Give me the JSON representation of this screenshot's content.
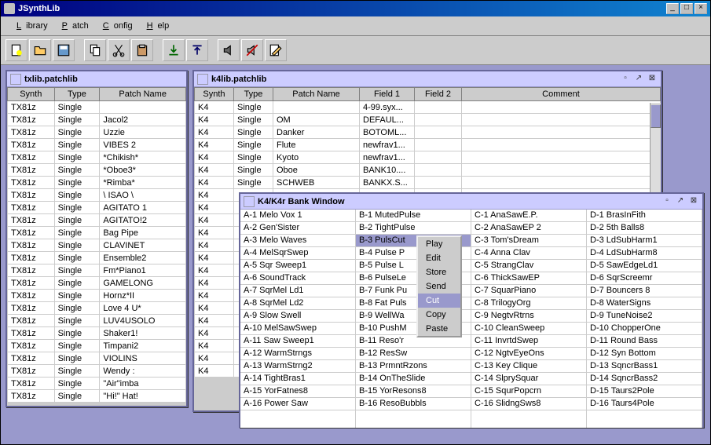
{
  "app": {
    "title": "JSynthLib"
  },
  "menubar": [
    "Library",
    "Patch",
    "Config",
    "Help"
  ],
  "toolbar_icons": [
    "new",
    "open",
    "save",
    "copy",
    "cut",
    "paste",
    "download",
    "upload",
    "sound",
    "strike",
    "edit"
  ],
  "win_txlib": {
    "title": "txlib.patchlib",
    "headers": [
      "Synth",
      "Type",
      "Patch Name"
    ],
    "rows": [
      [
        "TX81z",
        "Single",
        ""
      ],
      [
        "TX81z",
        "Single",
        " Jacol2"
      ],
      [
        "TX81z",
        "Single",
        " Uzzie"
      ],
      [
        "TX81z",
        "Single",
        " VIBES 2"
      ],
      [
        "TX81z",
        "Single",
        "*Chikish*"
      ],
      [
        "TX81z",
        "Single",
        "*Oboe3*"
      ],
      [
        "TX81z",
        "Single",
        "*Rimba*"
      ],
      [
        "TX81z",
        "Single",
        "\\ ISAO \\"
      ],
      [
        "TX81z",
        "Single",
        " AGITATO 1"
      ],
      [
        "TX81z",
        "Single",
        "AGITATO!2"
      ],
      [
        "TX81z",
        "Single",
        "Bag Pipe"
      ],
      [
        "TX81z",
        "Single",
        "CLAVINET"
      ],
      [
        "TX81z",
        "Single",
        "Ensemble2"
      ],
      [
        "TX81z",
        "Single",
        "Fm*Piano1"
      ],
      [
        "TX81z",
        "Single",
        "GAMELONG"
      ],
      [
        "TX81z",
        "Single",
        "Hornz*II"
      ],
      [
        "TX81z",
        "Single",
        "Love 4 U*"
      ],
      [
        "TX81z",
        "Single",
        "LUV4USOLO"
      ],
      [
        "TX81z",
        "Single",
        "Shaker1!"
      ],
      [
        "TX81z",
        "Single",
        "Timpani2"
      ],
      [
        "TX81z",
        "Single",
        "VIOLINS"
      ],
      [
        "TX81z",
        "Single",
        "Wendy : "
      ],
      [
        "TX81z",
        "Single",
        "\"Air\"imba"
      ],
      [
        "TX81z",
        "Single",
        "\"Hi!\" Hat!"
      ]
    ]
  },
  "win_k4lib": {
    "title": "k4lib.patchlib",
    "headers": [
      "Synth",
      "Type",
      "Patch Name",
      "Field 1",
      "Field 2",
      "Comment"
    ],
    "rows": [
      [
        "K4",
        "Single",
        "",
        "4-99.syx...",
        "",
        ""
      ],
      [
        "K4",
        "Single",
        "     OM",
        "DEFAUL...",
        "",
        ""
      ],
      [
        "K4",
        "Single",
        "Danker",
        "BOTOML...",
        "",
        ""
      ],
      [
        "K4",
        "Single",
        "Flute",
        "newfrav1...",
        "",
        ""
      ],
      [
        "K4",
        "Single",
        "Kyoto",
        "newfrav1...",
        "",
        ""
      ],
      [
        "K4",
        "Single",
        "Oboe",
        "BANK10....",
        "",
        ""
      ],
      [
        "K4",
        "Single",
        "SCHWEB",
        "BANKX.S...",
        "",
        ""
      ],
      [
        "K4",
        "",
        "",
        "",
        "",
        ""
      ],
      [
        "K4",
        "",
        "",
        "",
        "",
        ""
      ],
      [
        "K4",
        "",
        "",
        "",
        "",
        ""
      ],
      [
        "K4",
        "",
        "",
        "",
        "",
        ""
      ],
      [
        "K4",
        "",
        "",
        "",
        "",
        ""
      ],
      [
        "K4",
        "",
        "",
        "",
        "",
        ""
      ],
      [
        "K4",
        "",
        "",
        "",
        "",
        ""
      ],
      [
        "K4",
        "",
        "",
        "",
        "",
        ""
      ],
      [
        "K4",
        "",
        "",
        "",
        "",
        ""
      ],
      [
        "K4",
        "",
        "",
        "",
        "",
        ""
      ],
      [
        "K4",
        "",
        "",
        "",
        "",
        ""
      ],
      [
        "K4",
        "",
        "",
        "",
        "",
        ""
      ],
      [
        "K4",
        "",
        "",
        "",
        "",
        ""
      ],
      [
        "K4",
        "",
        "",
        "",
        "",
        ""
      ],
      [
        "K4",
        "",
        "",
        "",
        "",
        ""
      ]
    ]
  },
  "win_bank": {
    "title": "K4/K4r Bank Window",
    "cols": [
      [
        "A-1 Melo Vox 1",
        "A-2 Gen'Sister",
        "A-3 Melo Waves",
        "A-4 MelSqrSwep",
        "A-5 Sqr Sweep1",
        "A-6 SoundTrack",
        "A-7 SqrMel Ld1",
        "A-8 SqrMel Ld2",
        "A-9 Slow Swell",
        "A-10 MelSawSwep",
        "A-11 Saw Sweep1",
        "A-12 WarmStrngs",
        "A-13 WarmStrng2",
        "A-14 TightBras1",
        "A-15 YorFatnes8",
        "A-16 Power Saw"
      ],
      [
        "B-1 MutedPulse",
        "B-2 TightPulse",
        "B-3 PulsCut",
        "B-4 Pulse P",
        "B-5 Pulse L",
        "B-6 PulseLe",
        "B-7 Funk Pu",
        "B-8 Fat Puls",
        "B-9 WellWa",
        "B-10 PushM",
        "B-11 Reso'r",
        "B-12 ResSw",
        "B-13 PrmntRzons",
        "B-14 OnTheSlide",
        "B-15 YorResons8",
        "B-16 ResoBubbls"
      ],
      [
        "C-1 AnaSawE.P.",
        "C-2 AnaSawEP 2",
        "C-3 Tom'sDream",
        "C-4 Anna Clav",
        "C-5 StrangClav",
        "C-6 ThickSawEP",
        "C-7 SquarPiano",
        "C-8 TrilogyOrg",
        "C-9 NegtvRtrns",
        "C-10 CleanSweep",
        "C-11 InvrtdSwep",
        "C-12 NgtvEyeOns",
        "C-13 Key Clique",
        "C-14 SlprySquar",
        "C-15 SqurPopcrn",
        "C-16 SlidngSws8"
      ],
      [
        "D-1 BrasInFith",
        "D-2 5th Balls8",
        "D-3 LdSubHarm1",
        "D-4 LdSubHarm8",
        "D-5 SawEdgeLd1",
        "D-6 SqrScreemr",
        "D-7 Bouncers 8",
        "D-8 WaterSigns",
        "D-9 TuneNoise2",
        "D-10 ChopperOne",
        "D-11 Round Bass",
        "D-12 Syn Bottom",
        "D-13 SqncrBass1",
        "D-14 SqncrBass2",
        "D-15 Taurs2Pole",
        "D-16 Taurs4Pole"
      ]
    ],
    "selected_col": 1,
    "selected_row": 2
  },
  "popup": {
    "items": [
      "Play",
      "Edit",
      "Store",
      "Send",
      "Cut",
      "Copy",
      "Paste"
    ],
    "selected": "Cut"
  }
}
